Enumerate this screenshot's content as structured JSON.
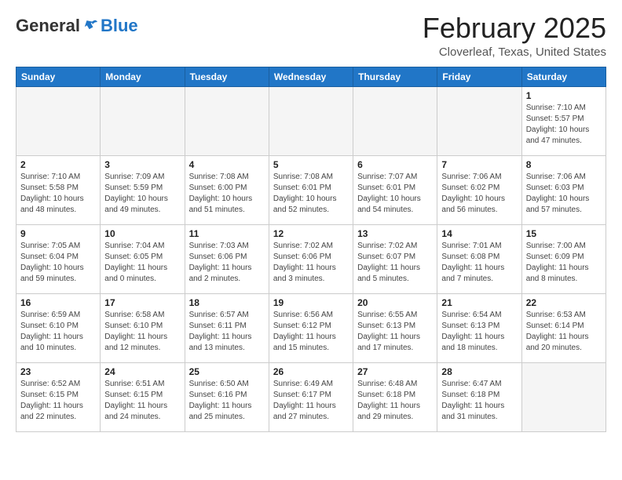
{
  "header": {
    "logo_general": "General",
    "logo_blue": "Blue",
    "month_title": "February 2025",
    "location": "Cloverleaf, Texas, United States"
  },
  "weekdays": [
    "Sunday",
    "Monday",
    "Tuesday",
    "Wednesday",
    "Thursday",
    "Friday",
    "Saturday"
  ],
  "weeks": [
    [
      {
        "day": "",
        "info": ""
      },
      {
        "day": "",
        "info": ""
      },
      {
        "day": "",
        "info": ""
      },
      {
        "day": "",
        "info": ""
      },
      {
        "day": "",
        "info": ""
      },
      {
        "day": "",
        "info": ""
      },
      {
        "day": "1",
        "info": "Sunrise: 7:10 AM\nSunset: 5:57 PM\nDaylight: 10 hours\nand 47 minutes."
      }
    ],
    [
      {
        "day": "2",
        "info": "Sunrise: 7:10 AM\nSunset: 5:58 PM\nDaylight: 10 hours\nand 48 minutes."
      },
      {
        "day": "3",
        "info": "Sunrise: 7:09 AM\nSunset: 5:59 PM\nDaylight: 10 hours\nand 49 minutes."
      },
      {
        "day": "4",
        "info": "Sunrise: 7:08 AM\nSunset: 6:00 PM\nDaylight: 10 hours\nand 51 minutes."
      },
      {
        "day": "5",
        "info": "Sunrise: 7:08 AM\nSunset: 6:01 PM\nDaylight: 10 hours\nand 52 minutes."
      },
      {
        "day": "6",
        "info": "Sunrise: 7:07 AM\nSunset: 6:01 PM\nDaylight: 10 hours\nand 54 minutes."
      },
      {
        "day": "7",
        "info": "Sunrise: 7:06 AM\nSunset: 6:02 PM\nDaylight: 10 hours\nand 56 minutes."
      },
      {
        "day": "8",
        "info": "Sunrise: 7:06 AM\nSunset: 6:03 PM\nDaylight: 10 hours\nand 57 minutes."
      }
    ],
    [
      {
        "day": "9",
        "info": "Sunrise: 7:05 AM\nSunset: 6:04 PM\nDaylight: 10 hours\nand 59 minutes."
      },
      {
        "day": "10",
        "info": "Sunrise: 7:04 AM\nSunset: 6:05 PM\nDaylight: 11 hours\nand 0 minutes."
      },
      {
        "day": "11",
        "info": "Sunrise: 7:03 AM\nSunset: 6:06 PM\nDaylight: 11 hours\nand 2 minutes."
      },
      {
        "day": "12",
        "info": "Sunrise: 7:02 AM\nSunset: 6:06 PM\nDaylight: 11 hours\nand 3 minutes."
      },
      {
        "day": "13",
        "info": "Sunrise: 7:02 AM\nSunset: 6:07 PM\nDaylight: 11 hours\nand 5 minutes."
      },
      {
        "day": "14",
        "info": "Sunrise: 7:01 AM\nSunset: 6:08 PM\nDaylight: 11 hours\nand 7 minutes."
      },
      {
        "day": "15",
        "info": "Sunrise: 7:00 AM\nSunset: 6:09 PM\nDaylight: 11 hours\nand 8 minutes."
      }
    ],
    [
      {
        "day": "16",
        "info": "Sunrise: 6:59 AM\nSunset: 6:10 PM\nDaylight: 11 hours\nand 10 minutes."
      },
      {
        "day": "17",
        "info": "Sunrise: 6:58 AM\nSunset: 6:10 PM\nDaylight: 11 hours\nand 12 minutes."
      },
      {
        "day": "18",
        "info": "Sunrise: 6:57 AM\nSunset: 6:11 PM\nDaylight: 11 hours\nand 13 minutes."
      },
      {
        "day": "19",
        "info": "Sunrise: 6:56 AM\nSunset: 6:12 PM\nDaylight: 11 hours\nand 15 minutes."
      },
      {
        "day": "20",
        "info": "Sunrise: 6:55 AM\nSunset: 6:13 PM\nDaylight: 11 hours\nand 17 minutes."
      },
      {
        "day": "21",
        "info": "Sunrise: 6:54 AM\nSunset: 6:13 PM\nDaylight: 11 hours\nand 18 minutes."
      },
      {
        "day": "22",
        "info": "Sunrise: 6:53 AM\nSunset: 6:14 PM\nDaylight: 11 hours\nand 20 minutes."
      }
    ],
    [
      {
        "day": "23",
        "info": "Sunrise: 6:52 AM\nSunset: 6:15 PM\nDaylight: 11 hours\nand 22 minutes."
      },
      {
        "day": "24",
        "info": "Sunrise: 6:51 AM\nSunset: 6:15 PM\nDaylight: 11 hours\nand 24 minutes."
      },
      {
        "day": "25",
        "info": "Sunrise: 6:50 AM\nSunset: 6:16 PM\nDaylight: 11 hours\nand 25 minutes."
      },
      {
        "day": "26",
        "info": "Sunrise: 6:49 AM\nSunset: 6:17 PM\nDaylight: 11 hours\nand 27 minutes."
      },
      {
        "day": "27",
        "info": "Sunrise: 6:48 AM\nSunset: 6:18 PM\nDaylight: 11 hours\nand 29 minutes."
      },
      {
        "day": "28",
        "info": "Sunrise: 6:47 AM\nSunset: 6:18 PM\nDaylight: 11 hours\nand 31 minutes."
      },
      {
        "day": "",
        "info": ""
      }
    ]
  ]
}
